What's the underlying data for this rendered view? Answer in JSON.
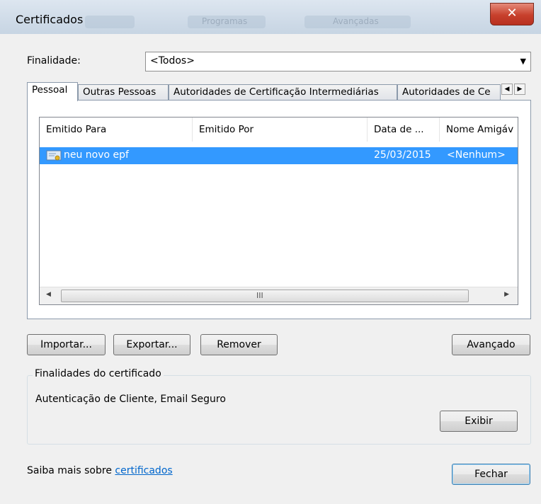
{
  "window": {
    "title": "Certificados",
    "close_glyph": "✕",
    "background_tabs": [
      "Programas",
      "Avançadas"
    ]
  },
  "purpose": {
    "label": "Finalidade:",
    "selected": "<Todos>"
  },
  "tabs": [
    {
      "label": "Pessoal",
      "active": true
    },
    {
      "label": "Outras Pessoas",
      "active": false
    },
    {
      "label": "Autoridades de Certificação Intermediárias",
      "active": false
    },
    {
      "label": "Autoridades de Ce",
      "active": false
    }
  ],
  "table": {
    "columns": [
      "Emitido Para",
      "Emitido Por",
      "Data de ...",
      "Nome Amigáv"
    ],
    "rows": [
      {
        "issued_to": "neu novo epf",
        "issued_by": "",
        "date": "25/03/2015",
        "friendly_name": "<Nenhum>",
        "selected": true,
        "icon": "certificate-icon"
      }
    ],
    "scroll_grip": "III"
  },
  "buttons": {
    "import": "Importar...",
    "export": "Exportar...",
    "remove": "Remover",
    "advanced": "Avançado",
    "view": "Exibir",
    "close": "Fechar"
  },
  "purposes_group": {
    "title": "Finalidades do certificado",
    "text": "Autenticação de Cliente, Email Seguro"
  },
  "footer": {
    "prefix": "Saiba mais sobre ",
    "link": "certificados"
  },
  "colors": {
    "selection": "#3399ff",
    "link": "#0066cc",
    "close_button": "#c7402c"
  }
}
